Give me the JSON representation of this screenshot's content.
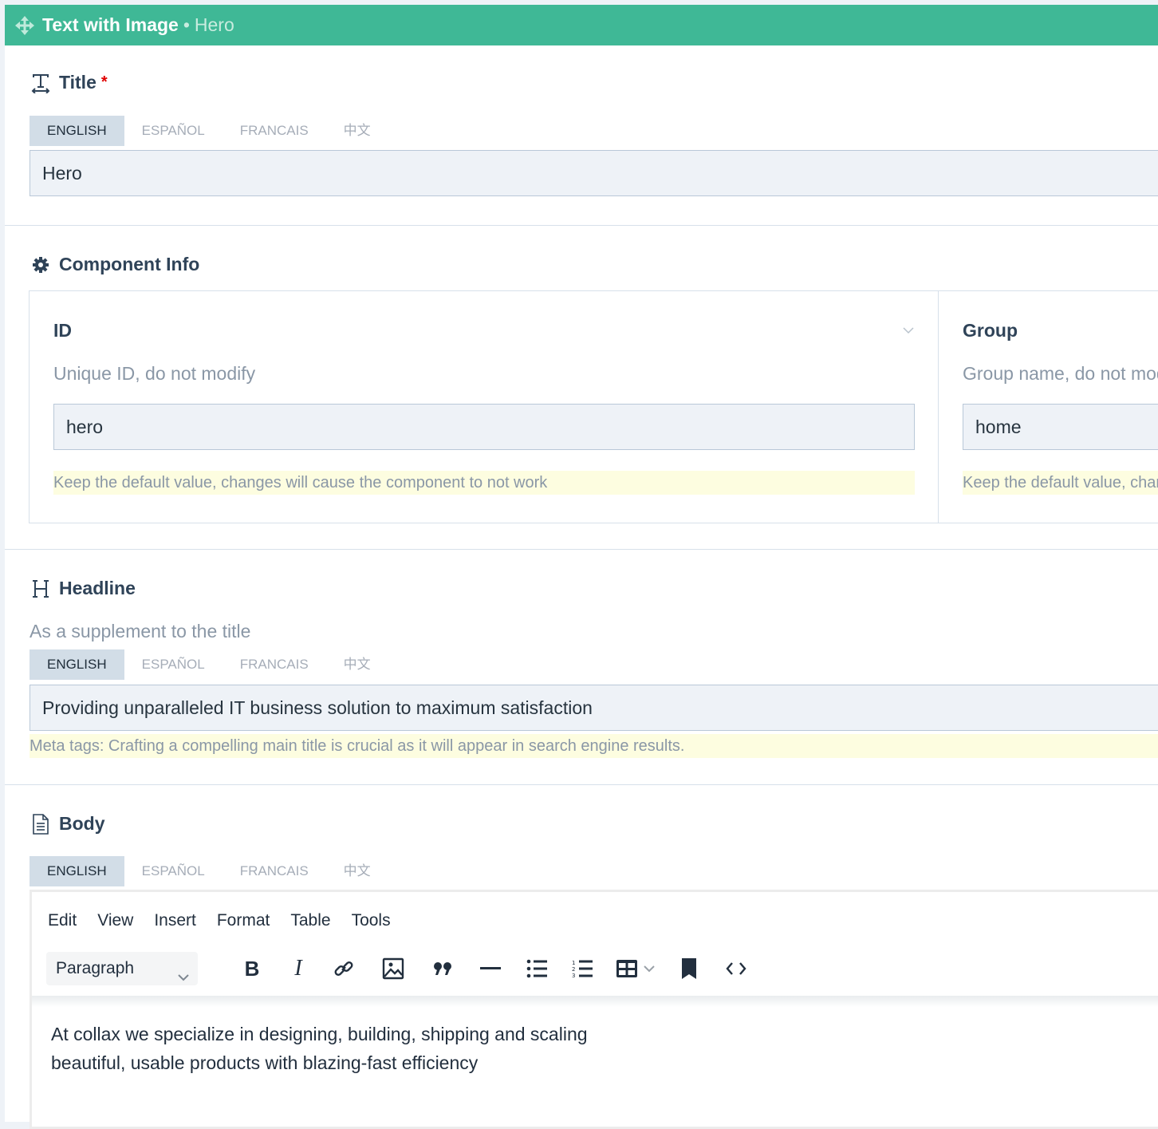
{
  "header": {
    "icon": "move-icon",
    "title": "Text with Image",
    "separator": "•",
    "subtitle": "Hero"
  },
  "colors": {
    "header_bg": "#3fb896",
    "active_tab_bg": "#d2dde7",
    "input_bg": "#eef2f7",
    "note_bg": "#fdfde0",
    "required": "#e00000"
  },
  "languages": [
    "ENGLISH",
    "ESPAÑOL",
    "FRANCAIS",
    "中文"
  ],
  "title_field": {
    "icon": "text-width-icon",
    "label": "Title",
    "required_mark": "*",
    "active_language": "ENGLISH",
    "value": "Hero"
  },
  "component_info": {
    "icon": "gear-icon",
    "label": "Component Info",
    "id": {
      "label": "ID",
      "description": "Unique ID, do not modify",
      "value": "hero",
      "note": "Keep the default value, changes will cause the component to not work"
    },
    "group": {
      "label": "Group",
      "description": "Group name, do not modify",
      "value": "home",
      "note": "Keep the default value, changes will cause the component to not work"
    }
  },
  "headline_field": {
    "icon": "heading-icon",
    "label": "Headline",
    "description": "As a supplement to the title",
    "active_language": "ENGLISH",
    "value": "Providing unparalleled IT business solution to maximum satisfaction",
    "note": "Meta tags: Crafting a compelling main title is crucial as it will appear in search engine results."
  },
  "body_field": {
    "icon": "document-icon",
    "label": "Body",
    "active_language": "ENGLISH",
    "editor": {
      "menu": [
        "Edit",
        "View",
        "Insert",
        "Format",
        "Table",
        "Tools"
      ],
      "block_format": "Paragraph",
      "toolbar": [
        "bold",
        "italic",
        "link",
        "image",
        "blockquote",
        "horizontal-rule",
        "bullet-list",
        "numbered-list",
        "table",
        "bookmark",
        "code"
      ],
      "content_lines": [
        "At collax we specialize in designing, building, shipping and scaling",
        "beautiful, usable products with blazing-fast efficiency"
      ]
    }
  }
}
